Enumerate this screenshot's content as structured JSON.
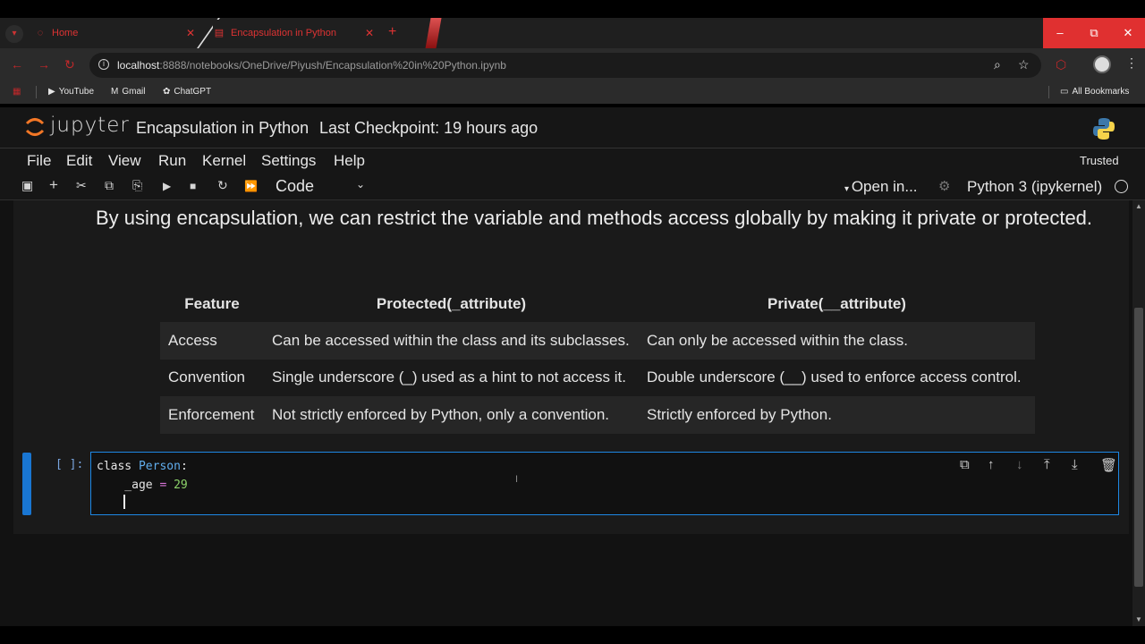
{
  "browser": {
    "tabs": [
      {
        "label": "Home",
        "icon": "jupyter-tab-icon",
        "active": false
      },
      {
        "label": "Encapsulation in Python",
        "icon": "notebook-tab-icon",
        "active": true
      }
    ],
    "new_tab": "+",
    "window_buttons": {
      "minimize": "–",
      "restore": "⧉",
      "close": "✕"
    },
    "url_host": "localhost",
    "url_rest": ":8888/notebooks/OneDrive/Piyush/Encapsulation%20in%20Python.ipynb",
    "bookmarks": [
      {
        "label": "YouTube",
        "icon": "youtube-icon"
      },
      {
        "label": "Gmail",
        "icon": "gmail-icon"
      },
      {
        "label": "ChatGPT",
        "icon": "chatgpt-icon"
      }
    ],
    "all_bookmarks": "All Bookmarks",
    "accent_color": "#c0282a"
  },
  "jupyter": {
    "logo_text": "jupyter",
    "notebook_title": "Encapsulation in Python",
    "checkpoint": "Last Checkpoint: 19 hours ago",
    "menu": [
      "File",
      "Edit",
      "View",
      "Run",
      "Kernel",
      "Settings",
      "Help"
    ],
    "trusted": "Trusted",
    "cell_type": "Code",
    "open_in": "Open in...",
    "kernel": "Python 3 (ipykernel)"
  },
  "markdown": {
    "paragraph": "By using encapsulation, we can restrict the variable and methods access globally by making it private or protected."
  },
  "table": {
    "headers": [
      "Feature",
      "Protected(_attribute)",
      "Private(__attribute)"
    ],
    "rows": [
      [
        "Access",
        "Can be accessed within the class and its subclasses.",
        "Can only be accessed within the class."
      ],
      [
        "Convention",
        "Single underscore (_) used as a hint to not access it.",
        "Double underscore (__) used to enforce access control."
      ],
      [
        "Enforcement",
        "Not strictly enforced by Python, only a convention.",
        "Strictly enforced by Python."
      ]
    ]
  },
  "code_cell": {
    "prompt": "[ ]:",
    "line1_kw": "class",
    "line1_name": "Person",
    "line1_colon": ":",
    "line2_var": "    _age",
    "line2_op": "=",
    "line2_num": "29"
  }
}
